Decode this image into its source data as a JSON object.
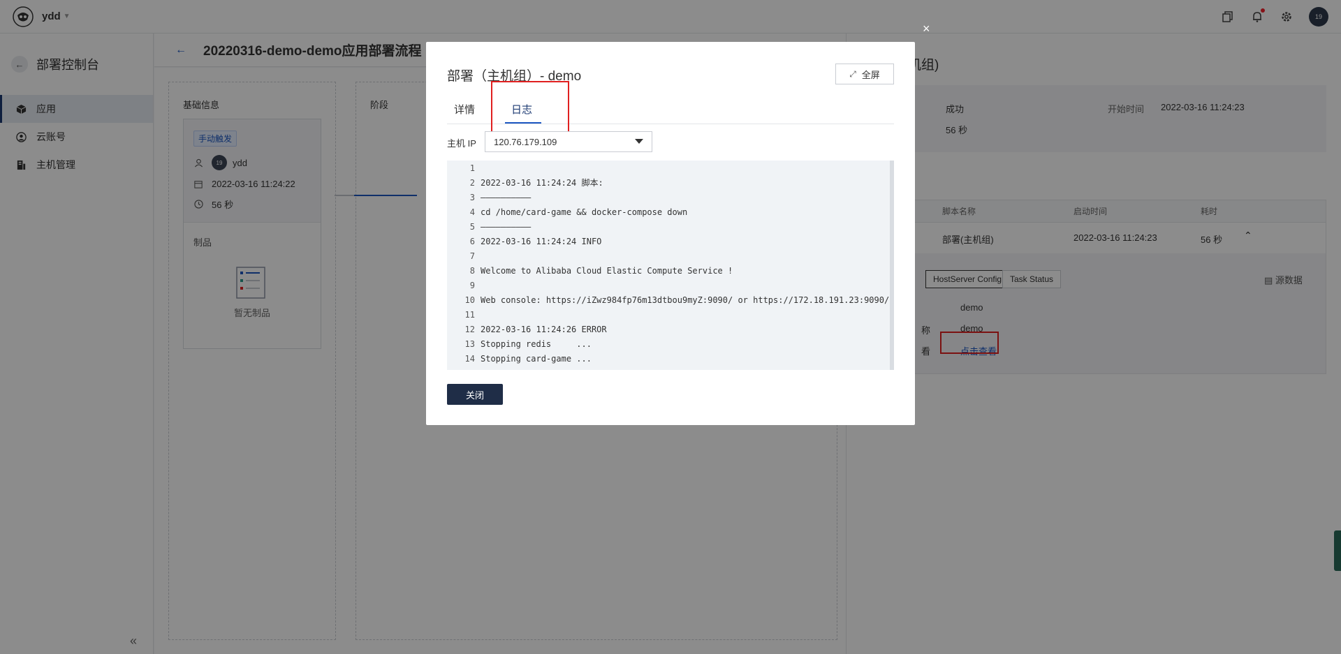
{
  "topbar": {
    "org": "ydd",
    "avatar": "19"
  },
  "sidebar": {
    "title": "部署控制台",
    "items": [
      {
        "label": "应用",
        "icon": "cube-icon"
      },
      {
        "label": "云账号",
        "icon": "user-circle-icon"
      },
      {
        "label": "主机管理",
        "icon": "server-icon"
      }
    ],
    "collapse": "«"
  },
  "main": {
    "title": "20220316-demo-demo应用部署流程",
    "basic_label": "基础信息",
    "stage_label": "阶段",
    "trigger_tag": "手动触发",
    "user_avatar": "19",
    "user": "ydd",
    "date": "2022-03-16 11:24:22",
    "duration": "56 秒",
    "artifacts_label": "制品",
    "artifacts_empty": "暂无制品"
  },
  "right_panel": {
    "title": "机组)",
    "status": "成功",
    "start_label": "开始时间",
    "start_time": "2022-03-16 11:24:23",
    "duration": "56 秒",
    "table": {
      "headers": [
        "脚本名称",
        "启动时间",
        "耗时"
      ],
      "row": [
        "部署(主机组)",
        "2022-03-16 11:24:23",
        "56 秒"
      ]
    },
    "tabs": [
      "HostServer Config",
      "Task Status"
    ],
    "source_data": "源数据",
    "values": [
      "demo",
      "demo"
    ],
    "label_fragments": [
      "称",
      "看"
    ],
    "link": "点击查看"
  },
  "modal": {
    "title": "部署（主机组）- demo",
    "fullscreen": "全屏",
    "close_x": "×",
    "tabs": [
      "详情",
      "日志"
    ],
    "ip_label": "主机 IP",
    "ip_value": "120.76.179.109",
    "log_lines": [
      "",
      "2022-03-16 11:24:24 脚本:",
      "——————————",
      "cd /home/card-game && docker-compose down",
      "——————————",
      "2022-03-16 11:24:24 INFO",
      "",
      "Welcome to Alibaba Cloud Elastic Compute Service !",
      "",
      "Web console: https://iZwz984fp76m13dtbou9myZ:9090/ or https://172.18.191.23:9090/",
      "",
      "2022-03-16 11:24:26 ERROR",
      "Stopping redis     ...",
      "Stopping card-game ..."
    ],
    "close_button": "关闭"
  },
  "colors": {
    "accent": "#1c57c2",
    "dark": "#1f2d47",
    "highlight": "#e02020",
    "success": "#2aa55a"
  }
}
